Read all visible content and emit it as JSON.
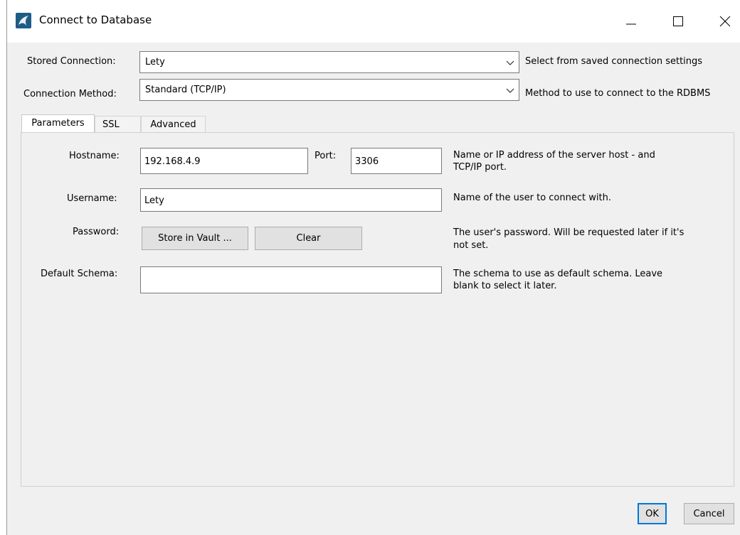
{
  "window": {
    "title": "Connect to Database",
    "icon": "mysql-dolphin-icon"
  },
  "stored_connection": {
    "label": "Stored Connection:",
    "value": "Lety",
    "hint": "Select from saved connection settings"
  },
  "connection_method": {
    "label": "Connection Method:",
    "value": "Standard (TCP/IP)",
    "hint": "Method to use to connect to the RDBMS"
  },
  "tabs": [
    {
      "label": "Parameters",
      "active": true
    },
    {
      "label": "SSL",
      "active": false
    },
    {
      "label": "Advanced",
      "active": false
    }
  ],
  "parameters": {
    "hostname_label": "Hostname:",
    "hostname_value": "192.168.4.9",
    "port_label": "Port:",
    "port_value": "3306",
    "hostname_hint_line1": "Name or IP address of the server host - and",
    "hostname_hint_line2": "TCP/IP port.",
    "username_label": "Username:",
    "username_value": "Lety",
    "username_hint": "Name of the user to connect with.",
    "password_label": "Password:",
    "store_in_vault_label": "Store in Vault ...",
    "clear_label": "Clear",
    "password_hint_line1": "The user's password. Will be requested later if it's",
    "password_hint_line2": "not set.",
    "default_schema_label": "Default Schema:",
    "default_schema_value": "",
    "default_schema_hint_line1": "The schema to use as default schema. Leave",
    "default_schema_hint_line2": "blank to select it later."
  },
  "footer": {
    "ok_label": "OK",
    "cancel_label": "Cancel"
  },
  "colors": {
    "accent": "#0078d7",
    "background": "#f0f0f0",
    "titlebar": "#ffffff"
  }
}
